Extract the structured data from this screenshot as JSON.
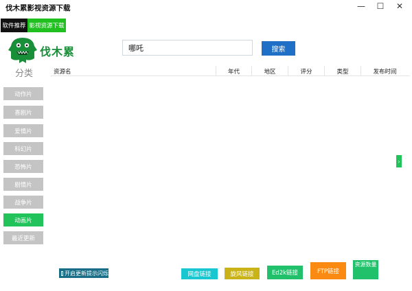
{
  "window": {
    "title": "伐木累影视资源下载",
    "controls": {
      "minimize": "—",
      "maximize": "☐",
      "close": "✕"
    }
  },
  "top_tabs": {
    "recommend": "软件推荐",
    "download": "影视资源下载"
  },
  "logo": {
    "text": "伐木累"
  },
  "search": {
    "value": "哪吒",
    "button": "搜索"
  },
  "sidebar": {
    "title": "分类",
    "items": [
      {
        "label": "动作片",
        "active": false
      },
      {
        "label": "喜剧片",
        "active": false
      },
      {
        "label": "爱情片",
        "active": false
      },
      {
        "label": "科幻片",
        "active": false
      },
      {
        "label": "恐怖片",
        "active": false
      },
      {
        "label": "剧情片",
        "active": false
      },
      {
        "label": "战争片",
        "active": false
      },
      {
        "label": "动画片",
        "active": true
      },
      {
        "label": "最近更新",
        "active": false
      }
    ]
  },
  "table": {
    "columns": [
      "资源名",
      "年代",
      "地区",
      "评分",
      "类型",
      "发布时间"
    ],
    "rows": []
  },
  "scroll_handle": {
    "glyph": "›"
  },
  "bottom": {
    "blink_toggle": "开启更新提示闪烁",
    "netdisk": "网盘链接",
    "xunlei": "旋风链接",
    "ed2k": "Ed2k链接",
    "ftp": "FTP链接",
    "resource_count": "资源数量"
  },
  "colors": {
    "accent_green": "#22c35a",
    "search_blue": "#1f6fc7",
    "category_gray": "#c4c4c4",
    "netdisk_cyan": "#18c7cf",
    "xunlei_yellow": "#c9b319",
    "ftp_orange": "#fb8a12",
    "blink_teal": "#176e86"
  }
}
